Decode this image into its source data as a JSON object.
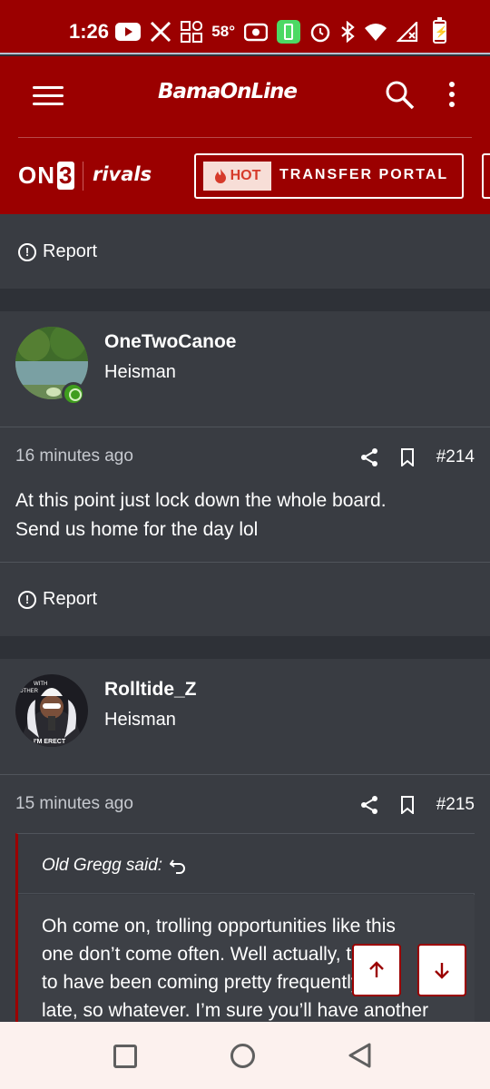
{
  "status_bar": {
    "time": "1:26",
    "temperature": "58°",
    "icons": [
      "youtube-icon",
      "x-icon",
      "grid-app-icon",
      "temperature",
      "camera-icon",
      "battery-saver-icon",
      "alarm-icon",
      "bluetooth-icon",
      "wifi-icon",
      "signal-icon",
      "battery-icon"
    ]
  },
  "header": {
    "site_name": "BamaOnLine",
    "on3_text": "ON",
    "on3_num": "3",
    "rivals_text": "rivals",
    "hot_label": "HOT",
    "transfer_label": "TRANSFER PORTAL",
    "colors": {
      "brand_red": "#9b0000",
      "hot_text": "#d63a2a",
      "hot_bg": "#f7ded7"
    }
  },
  "posts": [
    {
      "report_label": "Report"
    },
    {
      "username": "OneTwoCanoe",
      "user_title": "Heisman",
      "timestamp": "16 minutes ago",
      "post_number": "#214",
      "body_line1": "At this point just lock down the whole board.",
      "body_line2": "Send us home for the day lol",
      "report_label": "Report",
      "online": true
    },
    {
      "username": "Rolltide_Z",
      "user_title": "Heisman",
      "timestamp": "15 minutes ago",
      "post_number": "#215",
      "avatar_text_top": "WITH",
      "avatar_text_top2": "OTHER",
      "avatar_text_bottom": "I'M ERECT",
      "quote": {
        "author": "Old Gregg said:",
        "line1": "Oh come on, trolling opportunities like this",
        "line2": "one don’t come often. Well actually, these",
        "line3": "to have been coming pretty frequently of",
        "line4": "late, so whatever. I’m sure you’ll have another"
      }
    }
  ],
  "scroll_buttons": {
    "up": "scroll-up",
    "down": "scroll-down"
  }
}
